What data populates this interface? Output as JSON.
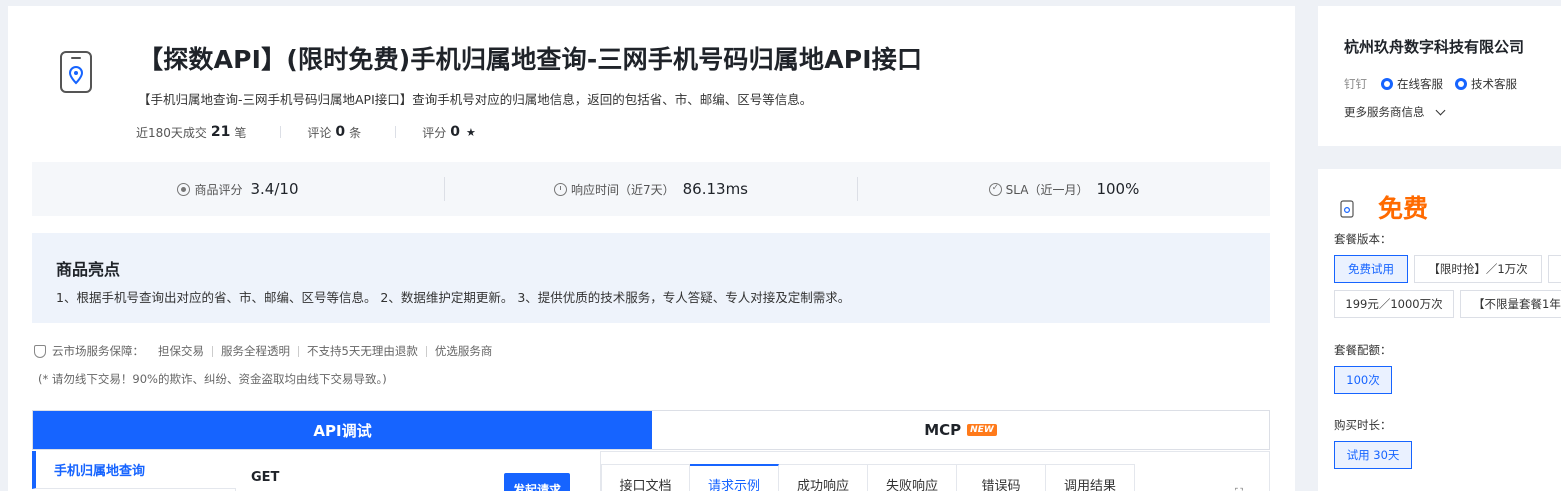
{
  "product": {
    "title": "【探数API】(限时免费)手机归属地查询-三网手机号码归属地API接口",
    "subtitle": "【手机归属地查询-三网手机号码归属地API接口】查询手机号对应的归属地信息，返回的包括省、市、邮编、区号等信息。",
    "stats": {
      "sales_label": "近180天成交",
      "sales_value": "21",
      "sales_unit": "笔",
      "reviews_label": "评论",
      "reviews_value": "0",
      "reviews_unit": "条",
      "rating_label": "评分",
      "rating_value": "0",
      "rating_star": "★"
    }
  },
  "metrics": [
    {
      "label": "商品评分",
      "value": "3.4/10"
    },
    {
      "label": "响应时间（近7天）",
      "value": "86.13ms"
    },
    {
      "label": "SLA（近一月）",
      "value": "100%"
    }
  ],
  "highlights": {
    "title": "商品亮点",
    "text": "1、根据手机号查询出对应的省、市、邮编、区号等信息。 2、数据维护定期更新。 3、提供优质的技术服务，专人答疑、专人对接及定制需求。"
  },
  "guarantee": {
    "label": "云市场服务保障：",
    "items": [
      "担保交易",
      "服务全程透明",
      "不支持5天无理由退款",
      "优选服务商"
    ],
    "warning": "(* 请勿线下交易！90%的欺诈、纠纷、资金盗取均由线下交易导致。)"
  },
  "tabs": {
    "api": "API调试",
    "mcp": "MCP",
    "mcp_badge": "NEW"
  },
  "api": {
    "side_item": "手机归属地查询",
    "method": "GET",
    "send_button": "发起请求",
    "doc_tabs": [
      "接口文档",
      "请求示例",
      "成功响应",
      "失败响应",
      "错误码",
      "调用结果"
    ],
    "active_doc_tab": 1
  },
  "seller": {
    "name": "杭州玖舟数字科技有限公司",
    "dingtalk": "钉钉",
    "online_service": "在线客服",
    "tech_service": "技术客服",
    "more_info": "更多服务商信息"
  },
  "pricing": {
    "price": "免费",
    "version_label": "套餐版本：",
    "versions": [
      "免费试用",
      "【限时抢】／1万次",
      "199元／1000万次",
      "【不限量套餐1年"
    ],
    "quota_label": "套餐配额：",
    "quota": "100次",
    "duration_label": "购买时长：",
    "duration": "试用 30天"
  },
  "colors": {
    "primary": "#1664ff",
    "price": "#ff6a00",
    "badge": "#ff7a1a"
  }
}
